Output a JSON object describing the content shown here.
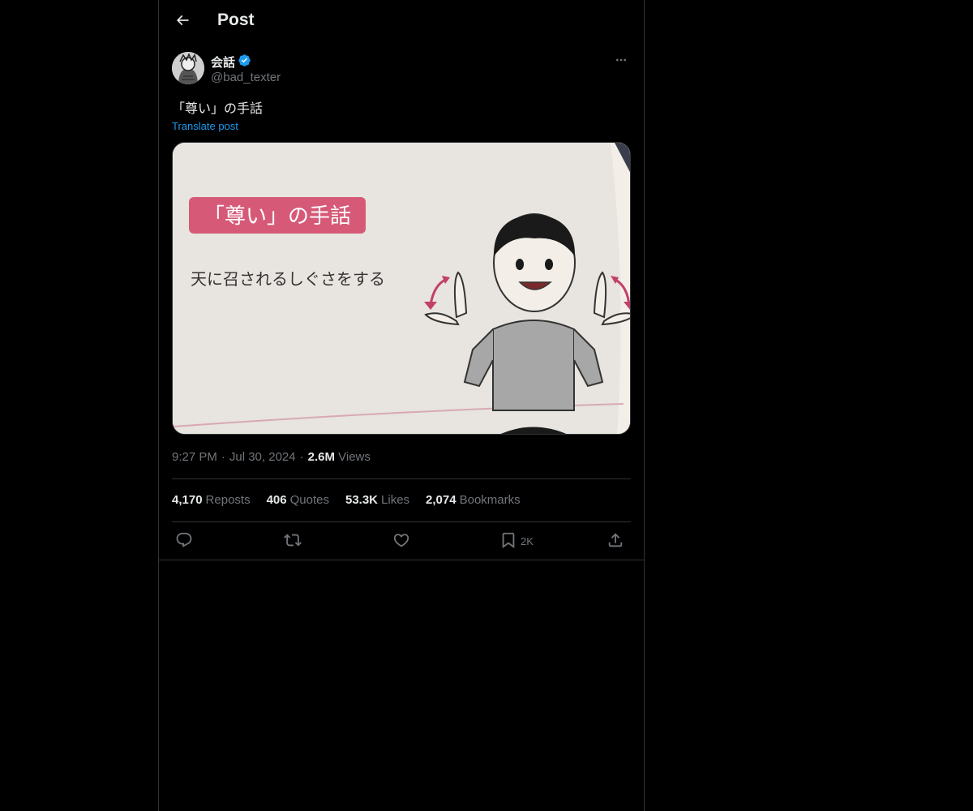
{
  "header": {
    "title": "Post"
  },
  "author": {
    "display_name": "会話",
    "verified": true,
    "handle": "@bad_texter"
  },
  "post": {
    "text": "「尊い」の手話",
    "translate_label": "Translate post",
    "image": {
      "banner_text": "「尊い」の手話",
      "caption_text": "天に召されるしぐさをする"
    }
  },
  "meta": {
    "time": "9:27 PM",
    "date": "Jul 30, 2024",
    "views_count": "2.6M",
    "views_label": "Views",
    "separator": "·"
  },
  "stats": {
    "reposts_count": "4,170",
    "reposts_label": "Reposts",
    "quotes_count": "406",
    "quotes_label": "Quotes",
    "likes_count": "53.3K",
    "likes_label": "Likes",
    "bookmarks_count": "2,074",
    "bookmarks_label": "Bookmarks"
  },
  "actions": {
    "reply_icon": "reply-icon",
    "repost_icon": "repost-icon",
    "like_icon": "heart-icon",
    "bookmark_icon": "bookmark-icon",
    "bookmark_count": "2K",
    "share_icon": "share-icon"
  },
  "colors": {
    "background": "#000000",
    "text": "#e7e9ea",
    "muted": "#71767b",
    "link": "#1d9bf0",
    "verified": "#1d9bf0",
    "divider": "#2f3336",
    "banner_pink": "#d65a78"
  }
}
